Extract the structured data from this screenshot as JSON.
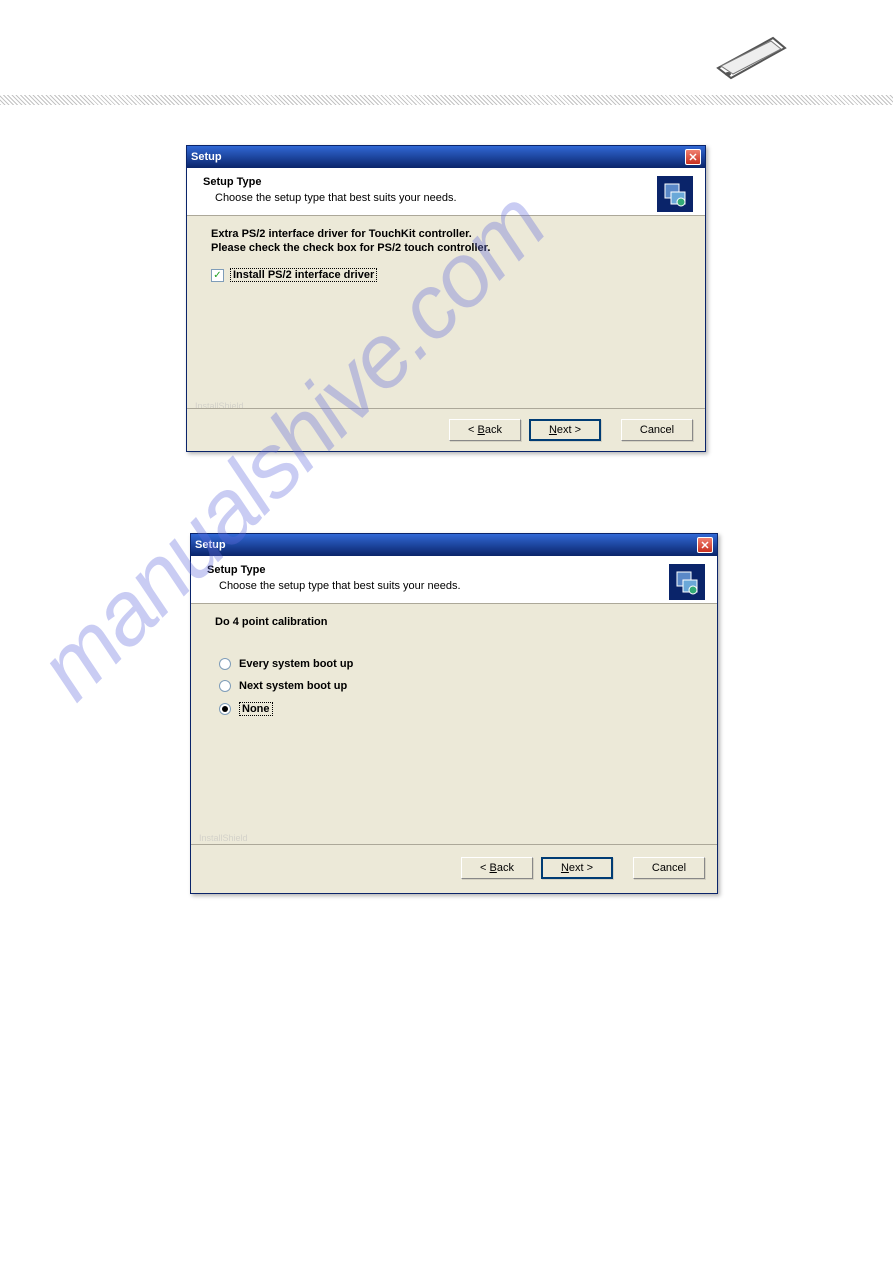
{
  "header": {
    "device_icon_name": "tablet-device-icon"
  },
  "dialog1": {
    "title": "Setup",
    "header_title": "Setup Type",
    "header_sub": "Choose the setup type that best suits your needs.",
    "desc_line1": "Extra PS/2 interface driver for TouchKit controller.",
    "desc_line2": "Please check the check box for PS/2 touch controller.",
    "checkbox": {
      "checked": true,
      "label": "Install PS/2 interface driver"
    },
    "watermark": "InstallShield",
    "buttons": {
      "back": "< Back",
      "next": "Next >",
      "cancel": "Cancel"
    }
  },
  "dialog2": {
    "title": "Setup",
    "header_title": "Setup Type",
    "header_sub": "Choose the setup type that best suits your needs.",
    "section_title": "Do 4 point calibration",
    "radios": [
      {
        "label": "Every system boot up",
        "checked": false
      },
      {
        "label": "Next system boot up",
        "checked": false
      },
      {
        "label": "None",
        "checked": true
      }
    ],
    "watermark": "InstallShield",
    "buttons": {
      "back": "< Back",
      "next": "Next >",
      "cancel": "Cancel"
    }
  },
  "page_watermark": "manualshive.com"
}
